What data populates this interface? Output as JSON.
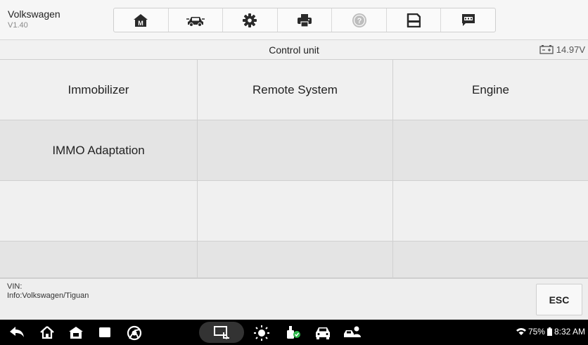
{
  "header": {
    "brand_name": "Volkswagen",
    "version": "V1.40",
    "toolbar": [
      {
        "name": "home-icon",
        "label": "M"
      },
      {
        "name": "car-vehicle-icon"
      },
      {
        "name": "settings-gear-icon"
      },
      {
        "name": "print-icon"
      },
      {
        "name": "help-icon"
      },
      {
        "name": "save-icon"
      },
      {
        "name": "message-icon"
      }
    ]
  },
  "titlebar": {
    "title": "Control unit",
    "voltage": "14.97V"
  },
  "grid": {
    "cells": [
      "Immobilizer",
      "Remote System",
      "Engine",
      "IMMO Adaptation",
      "",
      "",
      "",
      "",
      "",
      "",
      "",
      ""
    ]
  },
  "info": {
    "vin_label": "VIN:",
    "info_text": "Info:Volkswagen/Tiguan",
    "esc_label": "ESC"
  },
  "statusbar": {
    "battery_percent": "75%",
    "time": "8:32 AM"
  },
  "colors": {
    "header_bg": "#f6f6f6",
    "grid_row_light": "#f0f0f0",
    "grid_row_dark": "#e4e4e4",
    "navbar_bg": "#000000",
    "check_green": "#2db84a"
  }
}
